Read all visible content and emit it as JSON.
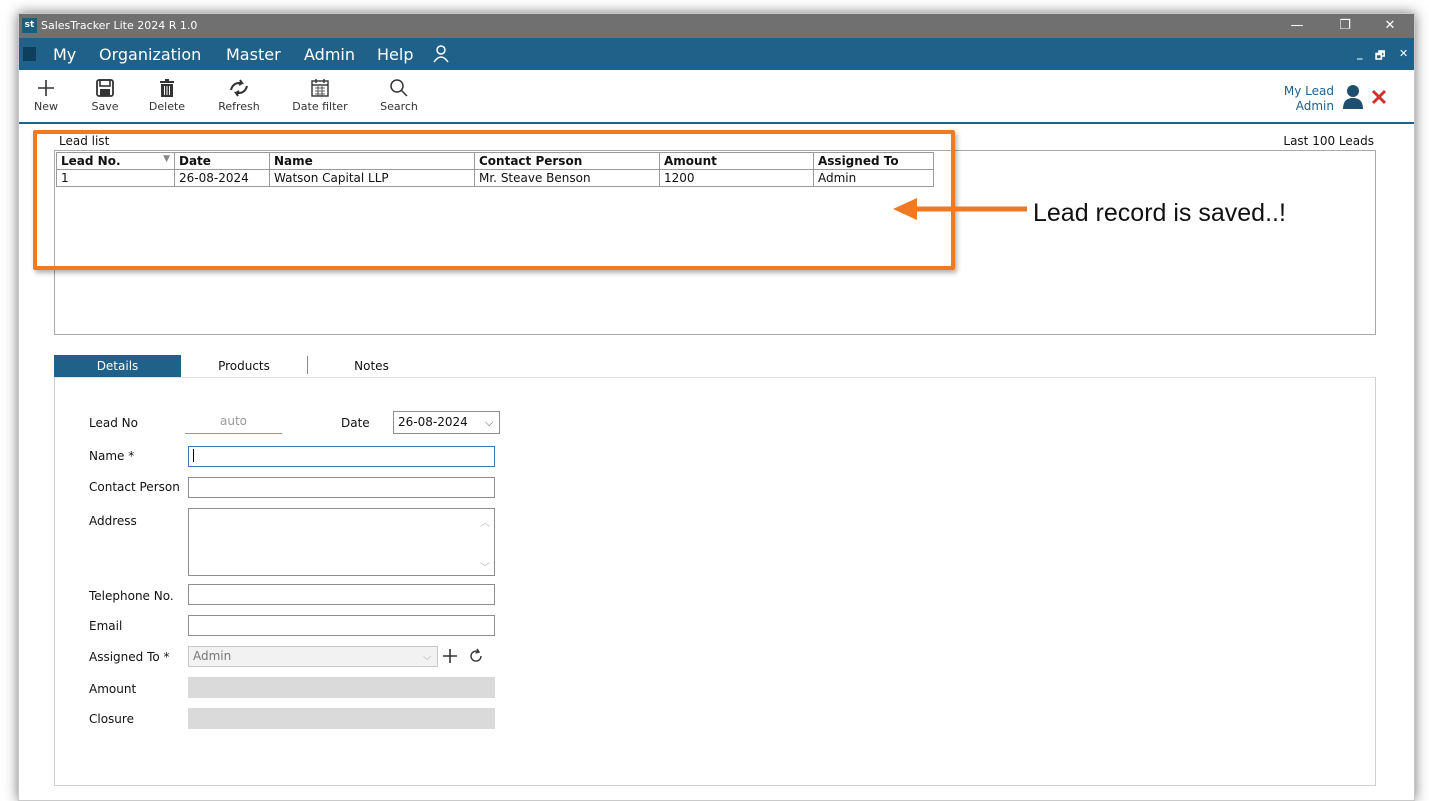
{
  "app": {
    "icon_text": "st",
    "title": "SalesTracker Lite 2024 R 1.0",
    "win_minimize": "—",
    "win_restore": "❐",
    "win_close": "✕"
  },
  "menu": {
    "items": [
      "My",
      "Organization",
      "Master",
      "Admin",
      "Help"
    ],
    "mdi_minimize": "_",
    "mdi_restore": "🗗",
    "mdi_close": "✕"
  },
  "toolbar": {
    "new_label": "New",
    "save_label": "Save",
    "delete_label": "Delete",
    "refresh_label": "Refresh",
    "date_filter_label": "Date filter",
    "search_label": "Search"
  },
  "user": {
    "module": "My Lead",
    "name": "Admin"
  },
  "lead_list": {
    "label": "Lead list",
    "count_label": "Last 100 Leads",
    "columns": [
      "Lead No.",
      "Date",
      "Name",
      "Contact Person",
      "Amount",
      "Assigned To"
    ],
    "rows": [
      [
        "1",
        "26-08-2024",
        "Watson Capital LLP",
        "Mr. Steave Benson",
        "1200",
        "Admin"
      ]
    ]
  },
  "annotation": {
    "callout_text": "Lead record is saved..!",
    "highlight_color": "#f07a22"
  },
  "tabs": {
    "details": "Details",
    "products": "Products",
    "notes": "Notes"
  },
  "form": {
    "lead_no_label": "Lead No",
    "lead_no_value": "auto",
    "date_label": "Date",
    "date_value": "26-08-2024",
    "name_label": "Name *",
    "name_value": "",
    "contact_label": "Contact Person",
    "contact_value": "",
    "address_label": "Address",
    "address_value": "",
    "telephone_label": "Telephone No.",
    "telephone_value": "",
    "email_label": "Email",
    "email_value": "",
    "assigned_label": "Assigned To *",
    "assigned_value": "Admin",
    "amount_label": "Amount",
    "amount_value": "",
    "closure_label": "Closure",
    "closure_value": ""
  },
  "colors": {
    "accent": "#1f6188",
    "titlebar": "#707070",
    "close_red": "#d32f2f"
  }
}
